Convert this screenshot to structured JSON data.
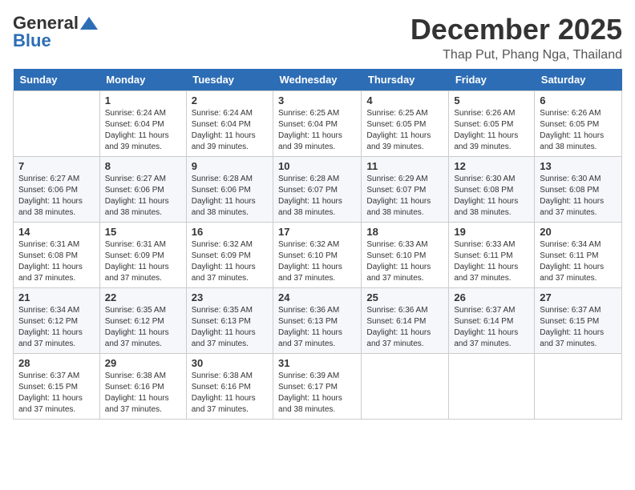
{
  "header": {
    "logo_general": "General",
    "logo_blue": "Blue",
    "month_title": "December 2025",
    "location": "Thap Put, Phang Nga, Thailand"
  },
  "weekdays": [
    "Sunday",
    "Monday",
    "Tuesday",
    "Wednesday",
    "Thursday",
    "Friday",
    "Saturday"
  ],
  "weeks": [
    [
      {
        "day": "",
        "detail": ""
      },
      {
        "day": "1",
        "detail": "Sunrise: 6:24 AM\nSunset: 6:04 PM\nDaylight: 11 hours\nand 39 minutes."
      },
      {
        "day": "2",
        "detail": "Sunrise: 6:24 AM\nSunset: 6:04 PM\nDaylight: 11 hours\nand 39 minutes."
      },
      {
        "day": "3",
        "detail": "Sunrise: 6:25 AM\nSunset: 6:04 PM\nDaylight: 11 hours\nand 39 minutes."
      },
      {
        "day": "4",
        "detail": "Sunrise: 6:25 AM\nSunset: 6:05 PM\nDaylight: 11 hours\nand 39 minutes."
      },
      {
        "day": "5",
        "detail": "Sunrise: 6:26 AM\nSunset: 6:05 PM\nDaylight: 11 hours\nand 39 minutes."
      },
      {
        "day": "6",
        "detail": "Sunrise: 6:26 AM\nSunset: 6:05 PM\nDaylight: 11 hours\nand 38 minutes."
      }
    ],
    [
      {
        "day": "7",
        "detail": "Sunrise: 6:27 AM\nSunset: 6:06 PM\nDaylight: 11 hours\nand 38 minutes."
      },
      {
        "day": "8",
        "detail": "Sunrise: 6:27 AM\nSunset: 6:06 PM\nDaylight: 11 hours\nand 38 minutes."
      },
      {
        "day": "9",
        "detail": "Sunrise: 6:28 AM\nSunset: 6:06 PM\nDaylight: 11 hours\nand 38 minutes."
      },
      {
        "day": "10",
        "detail": "Sunrise: 6:28 AM\nSunset: 6:07 PM\nDaylight: 11 hours\nand 38 minutes."
      },
      {
        "day": "11",
        "detail": "Sunrise: 6:29 AM\nSunset: 6:07 PM\nDaylight: 11 hours\nand 38 minutes."
      },
      {
        "day": "12",
        "detail": "Sunrise: 6:30 AM\nSunset: 6:08 PM\nDaylight: 11 hours\nand 38 minutes."
      },
      {
        "day": "13",
        "detail": "Sunrise: 6:30 AM\nSunset: 6:08 PM\nDaylight: 11 hours\nand 37 minutes."
      }
    ],
    [
      {
        "day": "14",
        "detail": "Sunrise: 6:31 AM\nSunset: 6:08 PM\nDaylight: 11 hours\nand 37 minutes."
      },
      {
        "day": "15",
        "detail": "Sunrise: 6:31 AM\nSunset: 6:09 PM\nDaylight: 11 hours\nand 37 minutes."
      },
      {
        "day": "16",
        "detail": "Sunrise: 6:32 AM\nSunset: 6:09 PM\nDaylight: 11 hours\nand 37 minutes."
      },
      {
        "day": "17",
        "detail": "Sunrise: 6:32 AM\nSunset: 6:10 PM\nDaylight: 11 hours\nand 37 minutes."
      },
      {
        "day": "18",
        "detail": "Sunrise: 6:33 AM\nSunset: 6:10 PM\nDaylight: 11 hours\nand 37 minutes."
      },
      {
        "day": "19",
        "detail": "Sunrise: 6:33 AM\nSunset: 6:11 PM\nDaylight: 11 hours\nand 37 minutes."
      },
      {
        "day": "20",
        "detail": "Sunrise: 6:34 AM\nSunset: 6:11 PM\nDaylight: 11 hours\nand 37 minutes."
      }
    ],
    [
      {
        "day": "21",
        "detail": "Sunrise: 6:34 AM\nSunset: 6:12 PM\nDaylight: 11 hours\nand 37 minutes."
      },
      {
        "day": "22",
        "detail": "Sunrise: 6:35 AM\nSunset: 6:12 PM\nDaylight: 11 hours\nand 37 minutes."
      },
      {
        "day": "23",
        "detail": "Sunrise: 6:35 AM\nSunset: 6:13 PM\nDaylight: 11 hours\nand 37 minutes."
      },
      {
        "day": "24",
        "detail": "Sunrise: 6:36 AM\nSunset: 6:13 PM\nDaylight: 11 hours\nand 37 minutes."
      },
      {
        "day": "25",
        "detail": "Sunrise: 6:36 AM\nSunset: 6:14 PM\nDaylight: 11 hours\nand 37 minutes."
      },
      {
        "day": "26",
        "detail": "Sunrise: 6:37 AM\nSunset: 6:14 PM\nDaylight: 11 hours\nand 37 minutes."
      },
      {
        "day": "27",
        "detail": "Sunrise: 6:37 AM\nSunset: 6:15 PM\nDaylight: 11 hours\nand 37 minutes."
      }
    ],
    [
      {
        "day": "28",
        "detail": "Sunrise: 6:37 AM\nSunset: 6:15 PM\nDaylight: 11 hours\nand 37 minutes."
      },
      {
        "day": "29",
        "detail": "Sunrise: 6:38 AM\nSunset: 6:16 PM\nDaylight: 11 hours\nand 37 minutes."
      },
      {
        "day": "30",
        "detail": "Sunrise: 6:38 AM\nSunset: 6:16 PM\nDaylight: 11 hours\nand 37 minutes."
      },
      {
        "day": "31",
        "detail": "Sunrise: 6:39 AM\nSunset: 6:17 PM\nDaylight: 11 hours\nand 38 minutes."
      },
      {
        "day": "",
        "detail": ""
      },
      {
        "day": "",
        "detail": ""
      },
      {
        "day": "",
        "detail": ""
      }
    ]
  ]
}
